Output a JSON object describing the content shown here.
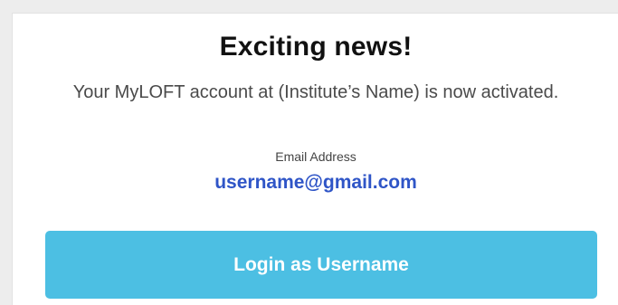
{
  "card": {
    "headline": "Exciting news!",
    "message": "Your MyLOFT account at (Institute’s Name) is now activated.",
    "email_label": "Email Address",
    "email_value": "username@gmail.com",
    "login_button_label": "Login as Username"
  },
  "colors": {
    "button_background": "#4cbfe3",
    "email_text": "#2f55c7"
  }
}
